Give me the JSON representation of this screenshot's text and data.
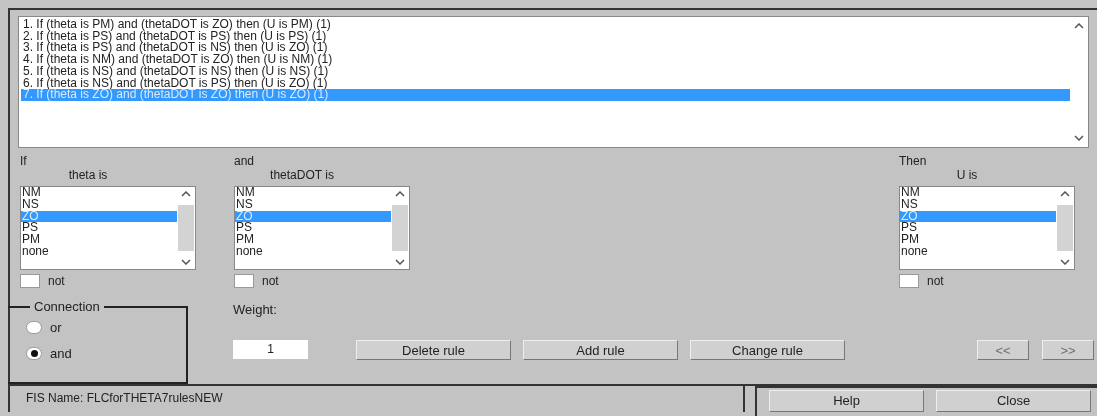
{
  "rules": [
    {
      "text": "1. If (theta is PM) and (thetaDOT is ZO) then (U is PM) (1)",
      "selected": false
    },
    {
      "text": "2. If (theta is PS) and (thetaDOT is PS) then (U is PS) (1)",
      "selected": false
    },
    {
      "text": "3. If (theta is PS) and (thetaDOT is NS) then (U is ZO) (1)",
      "selected": false
    },
    {
      "text": "4. If (theta is NM) and (thetaDOT is ZO) then (U is NM) (1)",
      "selected": false
    },
    {
      "text": "5. If (theta is NS) and (thetaDOT is NS) then (U is NS) (1)",
      "selected": false
    },
    {
      "text": "6. If (theta is NS) and (thetaDOT is PS) then (U is ZO) (1)",
      "selected": false
    },
    {
      "text": "7. If (theta is ZO) and (thetaDOT is ZO) then (U is ZO) (1)",
      "selected": true
    }
  ],
  "variables": [
    {
      "header": "If",
      "label": "theta is",
      "items": [
        {
          "label": "NM",
          "selected": false
        },
        {
          "label": "NS",
          "selected": false
        },
        {
          "label": "ZO",
          "selected": true
        },
        {
          "label": "PS",
          "selected": false
        },
        {
          "label": "PM",
          "selected": false
        },
        {
          "label": "none",
          "selected": false
        }
      ],
      "not": {
        "label": "not",
        "checked": false
      }
    },
    {
      "header": "and",
      "label": "thetaDOT is",
      "items": [
        {
          "label": "NM",
          "selected": false
        },
        {
          "label": "NS",
          "selected": false
        },
        {
          "label": "ZO",
          "selected": true
        },
        {
          "label": "PS",
          "selected": false
        },
        {
          "label": "PM",
          "selected": false
        },
        {
          "label": "none",
          "selected": false
        }
      ],
      "not": {
        "label": "not",
        "checked": false
      }
    },
    {
      "header": "Then",
      "label": "U is",
      "items": [
        {
          "label": "NM",
          "selected": false
        },
        {
          "label": "NS",
          "selected": false
        },
        {
          "label": "ZO",
          "selected": true
        },
        {
          "label": "PS",
          "selected": false
        },
        {
          "label": "PM",
          "selected": false
        },
        {
          "label": "none",
          "selected": false
        }
      ],
      "not": {
        "label": "not",
        "checked": false
      }
    }
  ],
  "connection": {
    "title": "Connection",
    "options": [
      {
        "label": "or",
        "selected": false
      },
      {
        "label": "and",
        "selected": true
      }
    ]
  },
  "weight": {
    "label": "Weight:",
    "value": "1"
  },
  "rule_buttons": [
    {
      "label": "Delete rule",
      "disabled": false
    },
    {
      "label": "Add rule",
      "disabled": false
    },
    {
      "label": "Change rule",
      "disabled": false
    }
  ],
  "nav_buttons": [
    {
      "label": "<<",
      "disabled": true
    },
    {
      "label": ">>",
      "disabled": true
    }
  ],
  "status": "FIS Name: FLCforTHETA7rulesNEW",
  "footer_buttons": [
    "Help",
    "Close"
  ]
}
